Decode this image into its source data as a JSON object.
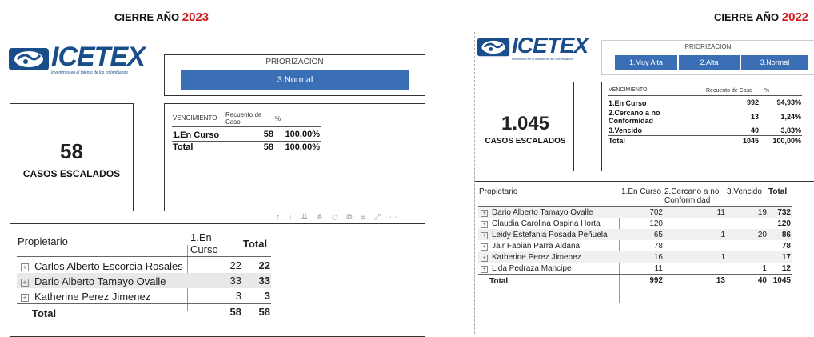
{
  "left": {
    "header_prefix": "CIERRE AÑO",
    "header_year": "2023",
    "logo": {
      "text": "ICETEX",
      "tagline": "Invertimos en el talento de los colombianos"
    },
    "priorizacion": {
      "title": "PRIORIZACION",
      "selected": "3.Normal"
    },
    "kpi": {
      "value": "58",
      "label": "CASOS ESCALADOS"
    },
    "vencimiento": {
      "headers": [
        "VENCIMIENTO",
        "Recuento de Caso",
        "%"
      ],
      "rows": [
        [
          "1.En Curso",
          "58",
          "100,00%"
        ]
      ],
      "total": [
        "Total",
        "58",
        "100,00%"
      ]
    },
    "propietario": {
      "headers": [
        "Propietario",
        "1.En Curso",
        "Total"
      ],
      "rows": [
        [
          "Carlos Alberto Escorcia Rosales",
          "22",
          "22"
        ],
        [
          "Dario Alberto Tamayo Ovalle",
          "33",
          "33"
        ],
        [
          "Katherine Perez Jimenez",
          "3",
          "3"
        ]
      ],
      "total": [
        "Total",
        "58",
        "58"
      ]
    }
  },
  "right": {
    "header_prefix": "CIERRE AÑO",
    "header_year": "2022",
    "logo": {
      "text": "ICETEX",
      "tagline": "Invertimos en el talento de los colombianos"
    },
    "priorizacion": {
      "title": "PRIORIZACION",
      "options": [
        "1.Muy Alta",
        "2.Alta",
        "3.Normal"
      ]
    },
    "kpi": {
      "value": "1.045",
      "label": "CASOS ESCALADOS"
    },
    "vencimiento": {
      "headers": [
        "VENCIMIENTO",
        "Recuento de Caso",
        "%"
      ],
      "rows": [
        [
          "1.En Curso",
          "992",
          "94,93%"
        ],
        [
          "2.Cercano a no Conformidad",
          "13",
          "1,24%"
        ],
        [
          "3.Vencido",
          "40",
          "3,83%"
        ]
      ],
      "total": [
        "Total",
        "1045",
        "100,00%"
      ]
    },
    "propietario": {
      "headers": [
        "Propietario",
        "1.En Curso",
        "2.Cercano a no Conformidad",
        "3.Vencido",
        "Total"
      ],
      "rows": [
        [
          "Dario Alberto Tamayo Ovalle",
          "702",
          "11",
          "19",
          "732"
        ],
        [
          "Claudia Carolina Ospina Horta",
          "120",
          "",
          "",
          "120"
        ],
        [
          "Leidy Estefania Posada Peñuela",
          "65",
          "1",
          "20",
          "86"
        ],
        [
          "Jair Fabian Parra Aldana",
          "78",
          "",
          "",
          "78"
        ],
        [
          "Katherine Perez Jimenez",
          "16",
          "1",
          "",
          "17"
        ],
        [
          "Lida Pedraza Mancipe",
          "11",
          "",
          "1",
          "12"
        ]
      ],
      "total": [
        "Total",
        "992",
        "13",
        "40",
        "1045"
      ]
    }
  },
  "colors": {
    "year_red": "#d11a1a",
    "button_blue": "#3a6fb5",
    "logo_blue": "#1a4e8a"
  }
}
